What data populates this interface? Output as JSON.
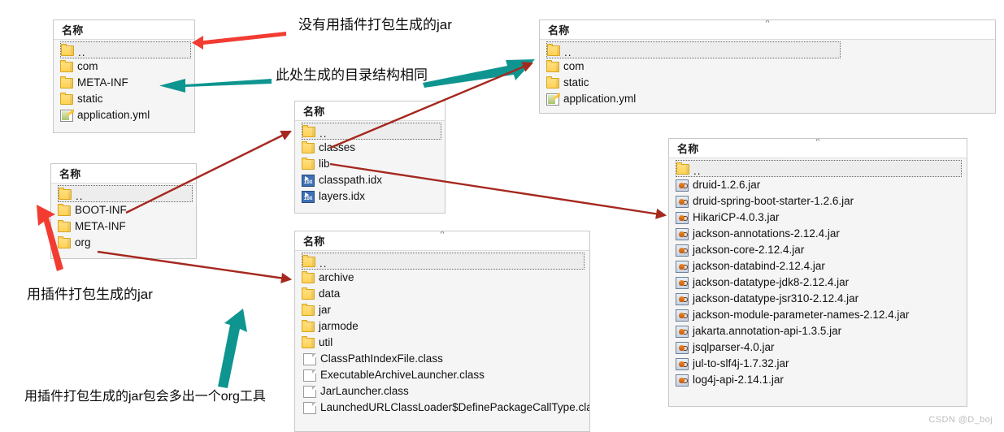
{
  "colors": {
    "red_arrow": "#f23c32",
    "teal_arrow": "#0f9590",
    "dark_red_arrow": "#a5281f",
    "folder_yellow": "#ffd255",
    "panel_bg": "#f5f5f5"
  },
  "column_header": "名称",
  "panels": {
    "plain_jar_root": {
      "name": "plain-jar-root-panel",
      "header": "名称",
      "rows": [
        {
          "label": "..",
          "icon": "folder-icon",
          "selected": true
        },
        {
          "label": "com",
          "icon": "folder-icon"
        },
        {
          "label": "META-INF",
          "icon": "folder-icon"
        },
        {
          "label": "static",
          "icon": "folder-icon"
        },
        {
          "label": "application.yml",
          "icon": "yml-file-icon"
        }
      ]
    },
    "classes_dir": {
      "name": "classes-directory-panel",
      "header": "名称",
      "rows": [
        {
          "label": "..",
          "icon": "folder-icon",
          "selected": true
        },
        {
          "label": "com",
          "icon": "folder-icon"
        },
        {
          "label": "static",
          "icon": "folder-icon"
        },
        {
          "label": "application.yml",
          "icon": "yml-file-icon"
        }
      ]
    },
    "boot_inf": {
      "name": "boot-inf-panel",
      "header": "名称",
      "rows": [
        {
          "label": "..",
          "icon": "folder-icon",
          "selected": true
        },
        {
          "label": "classes",
          "icon": "folder-icon"
        },
        {
          "label": "lib",
          "icon": "folder-icon"
        },
        {
          "label": "classpath.idx",
          "icon": "idx-file-icon"
        },
        {
          "label": "layers.idx",
          "icon": "idx-file-icon"
        }
      ]
    },
    "plugin_jar_root": {
      "name": "plugin-jar-root-panel",
      "header": "名称",
      "rows": [
        {
          "label": "..",
          "icon": "folder-icon",
          "selected": true
        },
        {
          "label": "BOOT-INF",
          "icon": "folder-icon"
        },
        {
          "label": "META-INF",
          "icon": "folder-icon"
        },
        {
          "label": "org",
          "icon": "folder-icon"
        }
      ]
    },
    "org_springframework_boot_loader": {
      "name": "org-loader-panel",
      "header": "名称",
      "rows": [
        {
          "label": "..",
          "icon": "folder-icon",
          "selected": true
        },
        {
          "label": "archive",
          "icon": "folder-icon"
        },
        {
          "label": "data",
          "icon": "folder-icon"
        },
        {
          "label": "jar",
          "icon": "folder-icon"
        },
        {
          "label": "jarmode",
          "icon": "folder-icon"
        },
        {
          "label": "util",
          "icon": "folder-icon"
        },
        {
          "label": "ClassPathIndexFile.class",
          "icon": "class-file-icon"
        },
        {
          "label": "ExecutableArchiveLauncher.class",
          "icon": "class-file-icon"
        },
        {
          "label": "JarLauncher.class",
          "icon": "class-file-icon"
        },
        {
          "label": "LaunchedURLClassLoader$DefinePackageCallType.class",
          "icon": "class-file-icon"
        }
      ]
    },
    "lib_jars": {
      "name": "lib-jars-panel",
      "header": "名称",
      "rows": [
        {
          "label": "..",
          "icon": "folder-icon",
          "selected": true
        },
        {
          "label": "druid-1.2.6.jar",
          "icon": "jar-file-icon"
        },
        {
          "label": "druid-spring-boot-starter-1.2.6.jar",
          "icon": "jar-file-icon"
        },
        {
          "label": "HikariCP-4.0.3.jar",
          "icon": "jar-file-icon"
        },
        {
          "label": "jackson-annotations-2.12.4.jar",
          "icon": "jar-file-icon"
        },
        {
          "label": "jackson-core-2.12.4.jar",
          "icon": "jar-file-icon"
        },
        {
          "label": "jackson-databind-2.12.4.jar",
          "icon": "jar-file-icon"
        },
        {
          "label": "jackson-datatype-jdk8-2.12.4.jar",
          "icon": "jar-file-icon"
        },
        {
          "label": "jackson-datatype-jsr310-2.12.4.jar",
          "icon": "jar-file-icon"
        },
        {
          "label": "jackson-module-parameter-names-2.12.4.jar",
          "icon": "jar-file-icon"
        },
        {
          "label": "jakarta.annotation-api-1.3.5.jar",
          "icon": "jar-file-icon"
        },
        {
          "label": "jsqlparser-4.0.jar",
          "icon": "jar-file-icon"
        },
        {
          "label": "jul-to-slf4j-1.7.32.jar",
          "icon": "jar-file-icon"
        },
        {
          "label": "log4j-api-2.14.1.jar",
          "icon": "jar-file-icon"
        }
      ]
    }
  },
  "annotations": {
    "no_plugin_jar": "没有用插件打包生成的jar",
    "same_structure": "此处生成的目录结构相同",
    "plugin_jar": "用插件打包生成的jar",
    "plugin_jar_org": "用插件打包生成的jar包会多出一个org工具"
  },
  "watermark": "CSDN @D_boj"
}
